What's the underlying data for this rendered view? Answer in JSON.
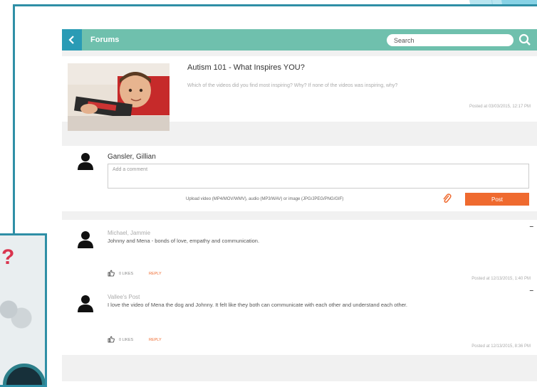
{
  "topbar": {
    "title": "Forums",
    "search_placeholder": "Search"
  },
  "post": {
    "title": "Autism 101 - What Inspires YOU?",
    "description": "Which of the videos did you find most inspiring? Why? If none of the videos was inspiring, why?",
    "posted_at": "Posted at 03/03/2015, 12:17 PM"
  },
  "comment_box": {
    "author": "Gansler, Gillian",
    "placeholder": "Add a comment",
    "upload_hint": "Upload video (MP4/MOV/WMV), audio (MP3/WAV) or image (JPG/JPEG/PNG/GIF)",
    "post_label": "Post"
  },
  "replies": [
    {
      "author": "Michael, Jammie",
      "text": "Johnny and Mena - bonds of love, empathy and communication.",
      "likes": "0 LIKES",
      "reply_label": "REPLY",
      "posted_at": "Posted at 12/13/2015, 1:40 PM"
    },
    {
      "author": "Vallee's Post",
      "text": "I love the video of Mena the dog and Johnny. It felt like they both can communicate with each other and understand each other.",
      "likes": "0 LIKES",
      "reply_label": "REPLY",
      "posted_at": "Posted at 12/13/2015, 8:36 PM"
    }
  ],
  "colors": {
    "topbar": "#6fc0ad",
    "back_button": "#2a9bb5",
    "accent": "#ef6a2f",
    "slide_border": "#2f8fa6"
  }
}
